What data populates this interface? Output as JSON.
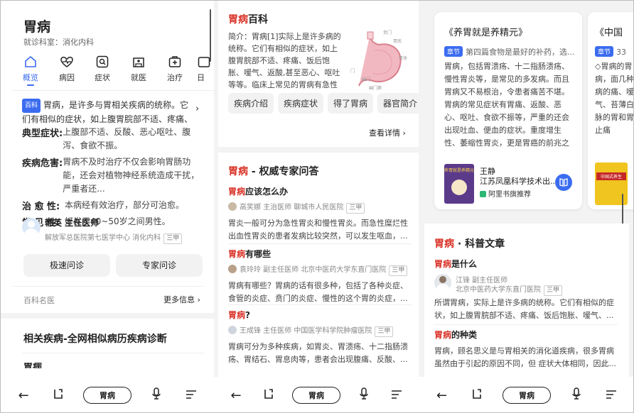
{
  "p1": {
    "title": "胃病",
    "dept": "就诊科室：消化内科",
    "tabs": [
      {
        "label": "概览",
        "icon": "home-icon"
      },
      {
        "label": "病因",
        "icon": "heartbeat-icon"
      },
      {
        "label": "症状",
        "icon": "search-square-icon"
      },
      {
        "label": "就医",
        "icon": "hospital-icon"
      },
      {
        "label": "治疗",
        "icon": "medkit-icon"
      },
      {
        "label": "日",
        "icon": "calendar-icon"
      }
    ],
    "badge": "百科",
    "summary": "胃病，是许多与胃相关疾病的统称。它们有相似的症状，如上腹胃脘部不适、疼痛、饭后饱",
    "facts": [
      {
        "label": "典型症状:",
        "value": "上腹部不适、反酸、恶心呕吐、腹泻、食欲不振。"
      },
      {
        "label": "疾病危害:",
        "value": "胃病不及时治疗不仅会影响胃肠功能，还会对植物神经系统造成干扰，严重者还..."
      },
      {
        "label": "治 愈 性:",
        "value": "本病经有效治疗，部分可治愈。"
      },
      {
        "label": "常 见 性:",
        "value": "好发于40~50岁之间男性。"
      }
    ],
    "doctor": {
      "name": "韩英 主任医师",
      "org": "解放军总医院第七医学中心 消化内科",
      "tag": "三甲"
    },
    "btn_fast": "极速问诊",
    "btn_expert": "专家问诊",
    "source": "百科名医",
    "more": "更多信息",
    "related_title": "相关疾病-全网相似病历疾病诊断",
    "related_peek": "胃病",
    "search": "胃病"
  },
  "p2": {
    "title_red": "胃病",
    "title_rest": "百科",
    "intro": "简介：胃病[1]实际上是许多病的统称。它们有相似的症状，如上腹胃脘部不适、疼痛、饭后饱胀、嗳气、返酸,甚至恶心、呕吐等等。临床上常见的胃病有急性胃炎、慢性胃炎、",
    "img_labels": [
      "贲门",
      "胃底",
      "胃体",
      "门",
      "幽门",
      "幽门窦"
    ],
    "chips": [
      "疾病介绍",
      "疾病症状",
      "得了胃病",
      "器官简介"
    ],
    "details": "查看详情",
    "qa_title_red": "胃病",
    "qa_title_rest": " - 权威专家问答",
    "qas": [
      {
        "q_red": "胃病",
        "q_rest": "应该怎么办",
        "doctor": "高笑娜 主治医师 聊城市人民医院",
        "tag": "三甲",
        "a": "胃炎一般可分为急性胃炎和慢性胃炎。而急性糜烂性出血性胃炎的患者发病比较突然，可以发生呕血，..."
      },
      {
        "q_red": "胃病",
        "q_rest": "有哪些",
        "doctor": "袁玲玲 副主任医师 北京中医药大学东直门医院",
        "tag": "三甲",
        "a": "胃病有哪些？胃病的话有很多种，包括了各种炎症、食管的炎症、贲门的炎症、慢性的这个胃的炎症，..."
      },
      {
        "q_red": "胃病",
        "q_rest": "?",
        "doctor": "王成锋 主任医师 中国医学科学院肿瘤医院",
        "tag": "三甲",
        "a": "胃病可分为多种疾病，如胃炎、胃溃疡、十二指肠溃疡、胃结石、胃息肉等，患者会出现腹痛、反酸、..."
      }
    ],
    "search": "胃病"
  },
  "p3": {
    "book1": {
      "title": "《养胃就是养精元》",
      "badge": "章节",
      "chapter": "第四篇食物是最好的补药，选...",
      "text": "胃病，包括胃溃疡、十二指肠溃疡、慢性胃炎等，是常见的多发病。而且胃病又不易根治，令患者痛苦不堪。　胃病的常见症状有胃痛、返酸、恶心、呕吐、食欲不振等，严重的还会出现吐血、便血的症状。重度增生性、萎缩性胃炎，更是胃癌的前兆之一　临床经验显示，用模榔可以治疗胃病。 ...",
      "cover": "养胃就是养精元",
      "author": "王静",
      "publisher": "江苏凤凰科学技术出...",
      "rec": "阿里书旗推荐"
    },
    "book2": {
      "title": "《中国",
      "badge": "章节",
      "chapter": "33",
      "text": "◇胃病的胃病，面几种病的痛、嗳气、苔薄白脉的胃和胃止痛",
      "cover": "中国式养生"
    },
    "art_title_red": "胃病",
    "art_title_rest": " · 科普文章",
    "articles": [
      {
        "t_red": "胃病",
        "t_rest": "是什么",
        "doc_name": "江锋 副主任医师",
        "doc_org": "北京中医药大学东直门医院",
        "tag": "三甲",
        "text": "所谓胃病，实际上是许多病的统称。它们有相似的症状，如上腹胃脘部不适、疼痛、饭后饱胀、嗳气、..."
      },
      {
        "t_red": "胃病",
        "t_rest": "的种类",
        "text": "胃病，顾名思义是与胃相关的消化道疾病，很多胃病虽然由于引起的原因不同，但 症状大体相同，因此..."
      }
    ],
    "search": "胃病"
  }
}
